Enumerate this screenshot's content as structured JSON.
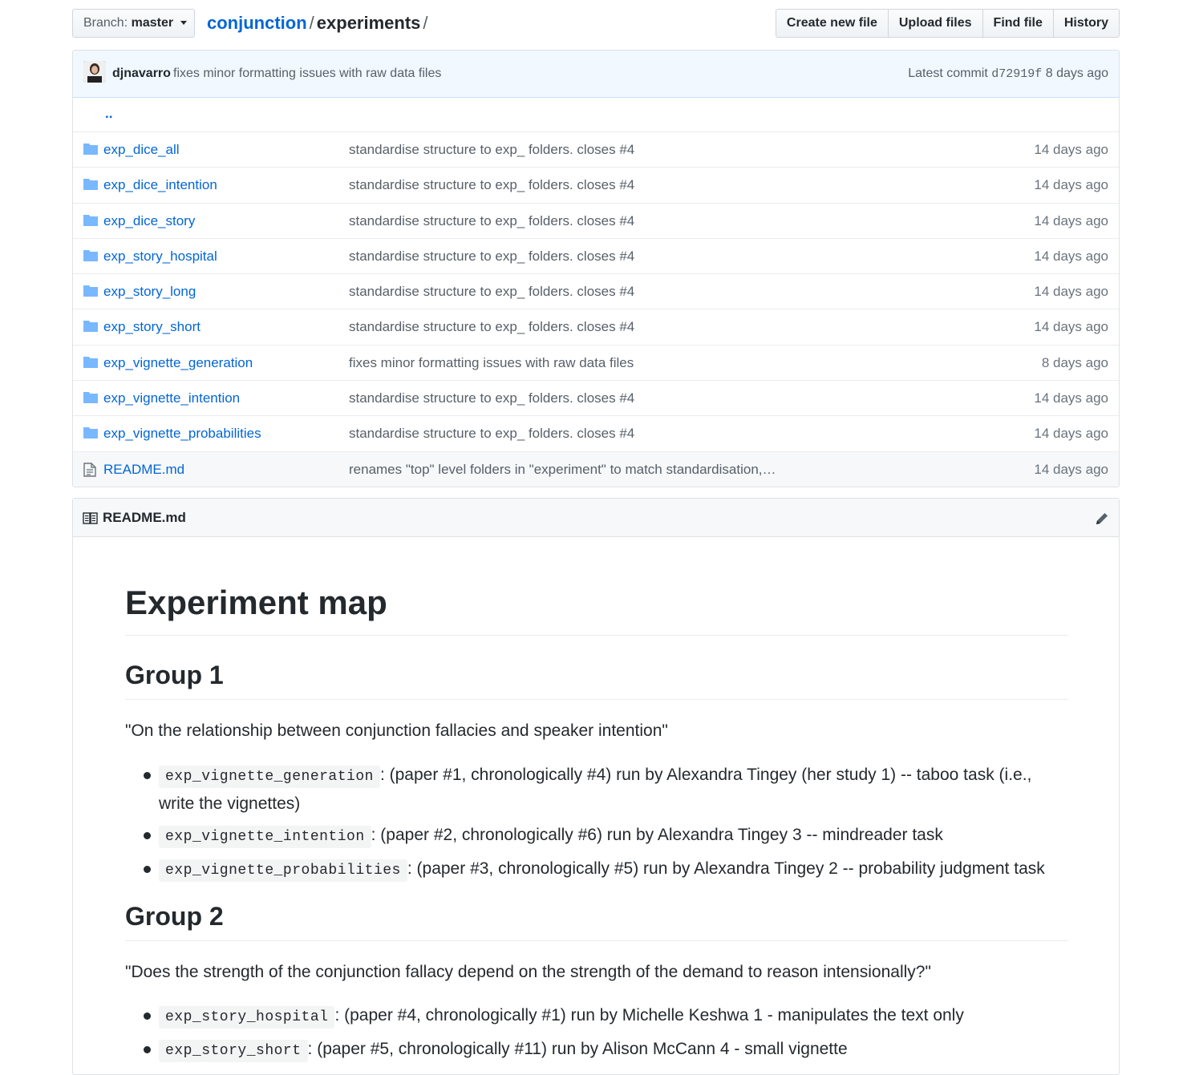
{
  "nav": {
    "branch_label": "Branch:",
    "branch_value": "master",
    "repo": "conjunction",
    "separator": "/",
    "folder": "experiments",
    "trail": "/"
  },
  "actions": {
    "create": "Create new file",
    "upload": "Upload files",
    "find": "Find file",
    "history": "History"
  },
  "commit": {
    "author": "djnavarro",
    "message": "fixes minor formatting issues with raw data files",
    "latest_label": "Latest commit",
    "sha": "d72919f",
    "age": "8 days ago"
  },
  "parent_dir": "..",
  "files": [
    {
      "name": "exp_dice_all",
      "type": "dir",
      "message": "standardise structure to exp_ folders. closes #4",
      "age": "14 days ago"
    },
    {
      "name": "exp_dice_intention",
      "type": "dir",
      "message": "standardise structure to exp_ folders. closes #4",
      "age": "14 days ago"
    },
    {
      "name": "exp_dice_story",
      "type": "dir",
      "message": "standardise structure to exp_ folders. closes #4",
      "age": "14 days ago"
    },
    {
      "name": "exp_story_hospital",
      "type": "dir",
      "message": "standardise structure to exp_ folders. closes #4",
      "age": "14 days ago"
    },
    {
      "name": "exp_story_long",
      "type": "dir",
      "message": "standardise structure to exp_ folders. closes #4",
      "age": "14 days ago"
    },
    {
      "name": "exp_story_short",
      "type": "dir",
      "message": "standardise structure to exp_ folders. closes #4",
      "age": "14 days ago"
    },
    {
      "name": "exp_vignette_generation",
      "type": "dir",
      "message": "fixes minor formatting issues with raw data files",
      "age": "8 days ago"
    },
    {
      "name": "exp_vignette_intention",
      "type": "dir",
      "message": "standardise structure to exp_ folders. closes #4",
      "age": "14 days ago"
    },
    {
      "name": "exp_vignette_probabilities",
      "type": "dir",
      "message": "standardise structure to exp_ folders. closes #4",
      "age": "14 days ago"
    },
    {
      "name": "README.md",
      "type": "file",
      "message": "renames \"top\" level folders in \"experiment\" to match standardisation,…",
      "age": "14 days ago"
    }
  ],
  "readme": {
    "filename": "README.md",
    "h1": "Experiment map",
    "group1": {
      "heading": "Group 1",
      "quote": "\"On the relationship between conjunction fallacies and speaker intention\"",
      "items": [
        {
          "code": "exp_vignette_generation",
          "text": ": (paper #1, chronologically #4) run by Alexandra Tingey (her study 1) -- taboo task (i.e., write the vignettes)"
        },
        {
          "code": "exp_vignette_intention",
          "text": ": (paper #2, chronologically #6) run by Alexandra Tingey 3 -- mindreader task"
        },
        {
          "code": "exp_vignette_probabilities",
          "text": ": (paper #3, chronologically #5) run by Alexandra Tingey 2 -- probability judgment task"
        }
      ]
    },
    "group2": {
      "heading": "Group 2",
      "quote": "\"Does the strength of the conjunction fallacy depend on the strength of the demand to reason intensionally?\"",
      "items": [
        {
          "code": "exp_story_hospital",
          "text": ": (paper #4, chronologically #1) run by Michelle Keshwa 1 - manipulates the text only"
        },
        {
          "code": "exp_story_short",
          "text": ": (paper #5, chronologically #11) run by Alison McCann 4 - small vignette"
        }
      ]
    }
  }
}
